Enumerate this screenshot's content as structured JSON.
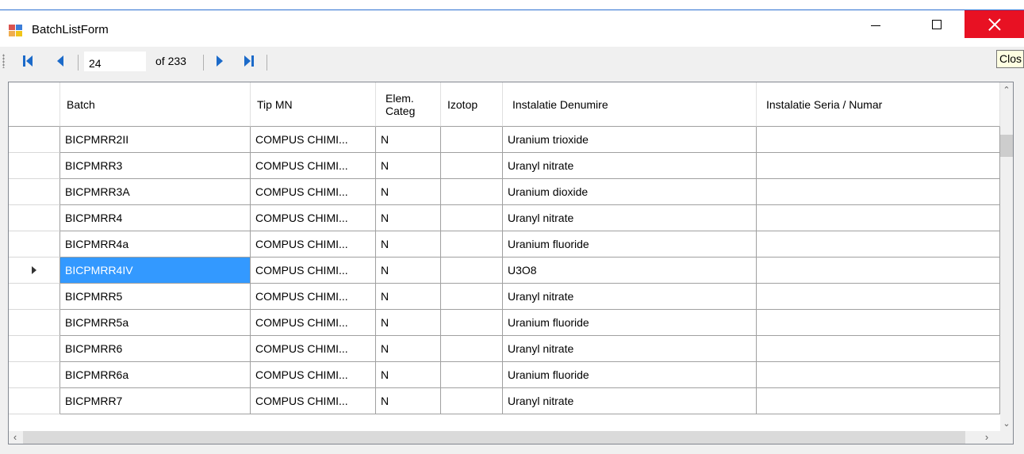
{
  "window": {
    "title": "BatchListForm",
    "close_tooltip": "Clos"
  },
  "navigator": {
    "position": "24",
    "count_label": "of 233"
  },
  "grid": {
    "columns": [
      "",
      "Batch",
      "Tip MN",
      "Elem.\nCateg",
      "Izotop",
      "Instalatie Denumire",
      "Instalatie Seria / Numar"
    ],
    "selected_row": 5,
    "rows": [
      {
        "batch": "BICPMRR2II",
        "tip": "COMPUS CHIMI...",
        "categ": "N",
        "izotop": "",
        "denumire": "Uranium trioxide",
        "seria": ""
      },
      {
        "batch": "BICPMRR3",
        "tip": "COMPUS CHIMI...",
        "categ": "N",
        "izotop": "",
        "denumire": "Uranyl nitrate",
        "seria": ""
      },
      {
        "batch": "BICPMRR3A",
        "tip": "COMPUS CHIMI...",
        "categ": "N",
        "izotop": "",
        "denumire": "Uranium dioxide",
        "seria": ""
      },
      {
        "batch": "BICPMRR4",
        "tip": "COMPUS CHIMI...",
        "categ": "N",
        "izotop": "",
        "denumire": "Uranyl nitrate",
        "seria": ""
      },
      {
        "batch": "BICPMRR4a",
        "tip": "COMPUS CHIMI...",
        "categ": "N",
        "izotop": "",
        "denumire": "Uranium fluoride",
        "seria": ""
      },
      {
        "batch": "BICPMRR4IV",
        "tip": "COMPUS CHIMI...",
        "categ": "N",
        "izotop": "",
        "denumire": "U3O8",
        "seria": ""
      },
      {
        "batch": "BICPMRR5",
        "tip": "COMPUS CHIMI...",
        "categ": "N",
        "izotop": "",
        "denumire": "Uranyl nitrate",
        "seria": ""
      },
      {
        "batch": "BICPMRR5a",
        "tip": "COMPUS CHIMI...",
        "categ": "N",
        "izotop": "",
        "denumire": "Uranium fluoride",
        "seria": ""
      },
      {
        "batch": "BICPMRR6",
        "tip": "COMPUS CHIMI...",
        "categ": "N",
        "izotop": "",
        "denumire": "Uranyl nitrate",
        "seria": ""
      },
      {
        "batch": "BICPMRR6a",
        "tip": "COMPUS CHIMI...",
        "categ": "N",
        "izotop": "",
        "denumire": "Uranium fluoride",
        "seria": ""
      },
      {
        "batch": "BICPMRR7",
        "tip": "COMPUS CHIMI...",
        "categ": "N",
        "izotop": "",
        "denumire": "Uranyl nitrate",
        "seria": ""
      }
    ]
  },
  "colors": {
    "selection": "#3399ff",
    "close_button": "#e81123",
    "nav_arrows": "#1b6ac9"
  },
  "icons": {
    "app": "form-icon",
    "first": "first-record-icon",
    "prev": "previous-record-icon",
    "next": "next-record-icon",
    "last": "last-record-icon"
  }
}
